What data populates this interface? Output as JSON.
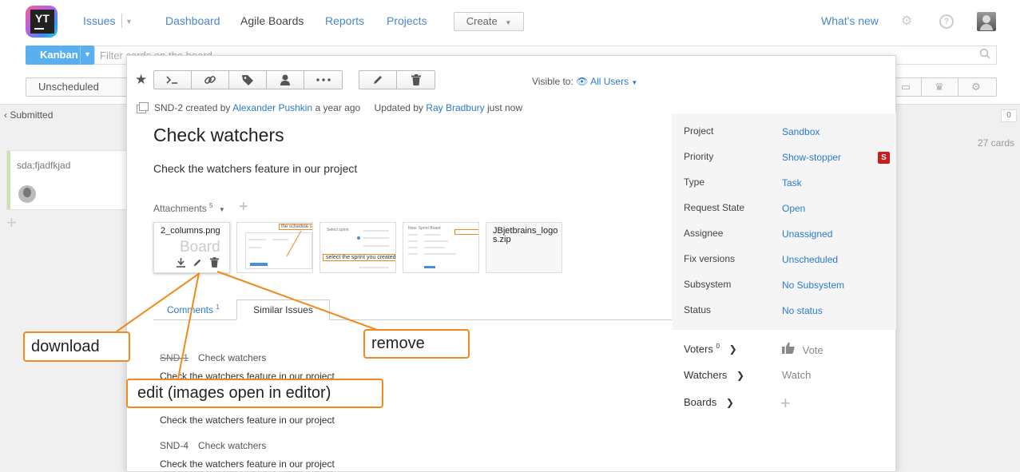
{
  "header": {
    "logo_text": "YT",
    "nav": [
      "Issues",
      "Dashboard",
      "Agile Boards",
      "Reports",
      "Projects"
    ],
    "create_label": "Create",
    "whats_new": "What's new"
  },
  "board": {
    "kanban_label": "Kanban",
    "filter_placeholder": "Filter cards on the board",
    "sprint_label": "Unscheduled",
    "column_title": "Submitted",
    "column_count": "0",
    "cards_count": "27 cards",
    "card_title": "sda;fjadfkjad"
  },
  "issue": {
    "visible_label": "Visible to:",
    "visible_value": "All Users",
    "id": "SND-2",
    "created_by_text": "created by",
    "author": "Alexander Pushkin",
    "created_ago": "a year ago",
    "updated_by_text": "Updated by",
    "updater": "Ray Bradbury",
    "updated_ago": "just now",
    "title": "Check watchers",
    "description": "Check the watchers feature in our project",
    "attachments_label": "Attachments",
    "attachments_count": "5",
    "attachments": [
      {
        "name": "2_columns.png",
        "ghost_text": "Board"
      },
      {
        "name": "JBjetbrains_logos.zip"
      }
    ],
    "thumb_snippets": {
      "t2": "the schedule sets it",
      "t3_a": "Select sprint",
      "t3_b": "select the sprint you created",
      "t4": "New: Sprint Board"
    },
    "tabs": {
      "comments": "Comments",
      "comments_count": "1",
      "similar": "Similar Issues"
    },
    "similar": [
      {
        "id": "SND-1",
        "summary": "Check watchers",
        "description": "Check the watchers feature in our project"
      },
      {
        "id": "",
        "summary": "",
        "description": "Check the watchers feature in our project"
      },
      {
        "id": "SND-4",
        "summary": "Check watchers",
        "description": "Check the watchers feature in our project"
      }
    ]
  },
  "fields": [
    {
      "name": "Project",
      "value": "Sandbox"
    },
    {
      "name": "Priority",
      "value": "Show-stopper",
      "badge": "S"
    },
    {
      "name": "Type",
      "value": "Task"
    },
    {
      "name": "Request State",
      "value": "Open"
    },
    {
      "name": "Assignee",
      "value": "Unassigned"
    },
    {
      "name": "Fix versions",
      "value": "Unscheduled"
    },
    {
      "name": "Subsystem",
      "value": "No Subsystem"
    },
    {
      "name": "Status",
      "value": "No status"
    }
  ],
  "social": {
    "voters_label": "Voters",
    "voters_count": "0",
    "vote_label": "Vote",
    "watchers_label": "Watchers",
    "watch_label": "Watch",
    "boards_label": "Boards"
  },
  "callouts": {
    "download": "download",
    "edit": "edit (images open in editor)",
    "remove": "remove"
  },
  "colors": {
    "accent": "#2a7bd0",
    "callout": "#f08a1c",
    "kanban": "#5aaff0",
    "priority_badge": "#cc1b1b"
  }
}
